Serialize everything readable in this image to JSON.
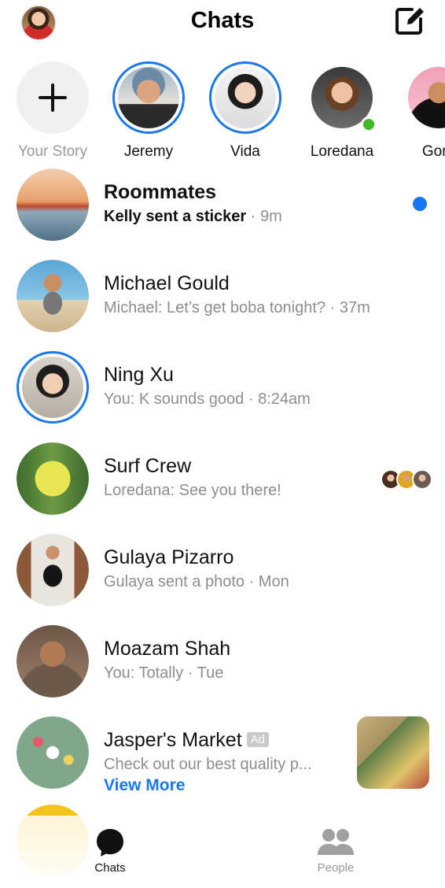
{
  "header": {
    "title": "Chats",
    "profile_icon": "profile-avatar",
    "compose_icon": "compose-icon"
  },
  "stories": [
    {
      "name": "Your Story",
      "type": "add"
    },
    {
      "name": "Jeremy",
      "active": true
    },
    {
      "name": "Vida",
      "active": true
    },
    {
      "name": "Loredana",
      "online": true
    },
    {
      "name": "Gord"
    }
  ],
  "chats": [
    {
      "name": "Roommates",
      "preview": "Kelly sent a sticker",
      "time": "· 9m",
      "unread": true
    },
    {
      "name": "Michael Gould",
      "preview": "Michael: Let’s get boba tonight?",
      "time": "· 37m"
    },
    {
      "name": "Ning Xu",
      "preview": "You: K sounds good",
      "time": "· 8:24am"
    },
    {
      "name": "Surf Crew",
      "preview": "Loredana: See you there!",
      "time": ""
    },
    {
      "name": "Gulaya Pizarro",
      "preview": "Gulaya sent a photo",
      "time": "· Mon"
    },
    {
      "name": "Moazam Shah",
      "preview": "You: Totally",
      "time": "· Tue"
    }
  ],
  "ad": {
    "name": "Jasper's Market",
    "badge": "Ad",
    "preview": "Check out our best quality p...",
    "cta": "View More"
  },
  "tabs": [
    {
      "label": "Chats",
      "icon": "chat-bubble-icon",
      "active": true
    },
    {
      "label": "People",
      "icon": "people-icon",
      "active": false
    }
  ],
  "colors": {
    "accent": "#1877f2",
    "online": "#42b72a",
    "muted_text": "#8e8e8e"
  }
}
